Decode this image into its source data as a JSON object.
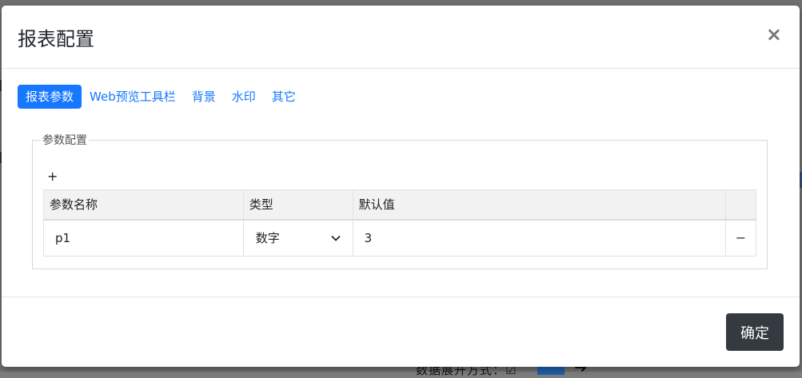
{
  "dialog": {
    "title": "报表配置",
    "close_label": "×"
  },
  "tabs": [
    {
      "label": "报表参数",
      "active": true
    },
    {
      "label": "Web预览工具栏",
      "active": false
    },
    {
      "label": "背景",
      "active": false
    },
    {
      "label": "水印",
      "active": false
    },
    {
      "label": "其它",
      "active": false
    }
  ],
  "params_section": {
    "legend": "参数配置",
    "add_label": "+",
    "columns": [
      "参数名称",
      "类型",
      "默认值",
      ""
    ],
    "rows": [
      {
        "name": "p1",
        "type": "数字",
        "default": "3",
        "remove_label": "−"
      }
    ]
  },
  "footer": {
    "confirm_label": "确定"
  },
  "background": {
    "bottom_text": "数据展开方式：☑",
    "arrow": "➜"
  },
  "colors": {
    "accent": "#1677ff",
    "confirm": "#343a40"
  }
}
